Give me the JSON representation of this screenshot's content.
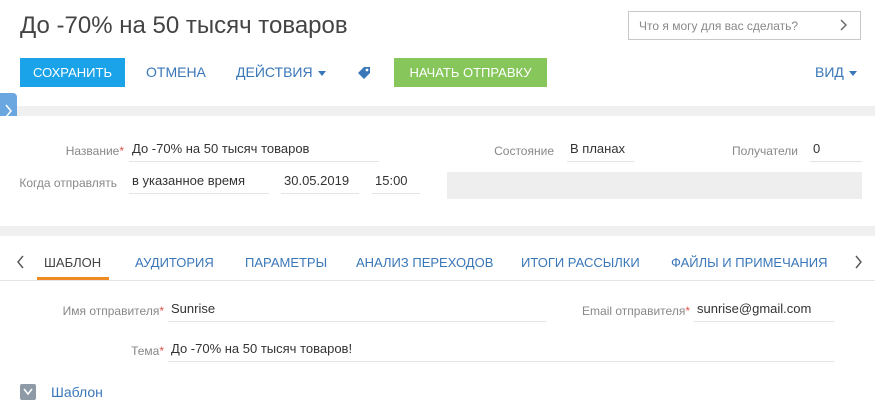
{
  "header": {
    "title": "До -70% на 50 тысяч товаров",
    "assistant_placeholder": "Что я могу для вас сделать?"
  },
  "toolbar": {
    "save_label": "СОХРАНИТЬ",
    "cancel_label": "ОТМЕНА",
    "actions_label": "ДЕЙСТВИЯ",
    "start_send_label": "НАЧАТЬ ОТПРАВКУ",
    "view_label": "ВИД"
  },
  "details": {
    "name_label": "Название",
    "name_value": "До -70% на 50 тысяч товаров",
    "when_label": "Когда отправлять",
    "when_mode": "в указанное время",
    "when_date": "30.05.2019",
    "when_time": "15:00",
    "state_label": "Состояние",
    "state_value": "В планах",
    "recipients_label": "Получатели",
    "recipients_value": "0"
  },
  "tabs": [
    {
      "label": "ШАБЛОН"
    },
    {
      "label": "АУДИТОРИЯ"
    },
    {
      "label": "ПАРАМЕТРЫ"
    },
    {
      "label": "АНАЛИЗ ПЕРЕХОДОВ"
    },
    {
      "label": "ИТОГИ РАССЫЛКИ"
    },
    {
      "label": "ФАЙЛЫ И ПРИМЕЧАНИЯ"
    }
  ],
  "template_tab": {
    "sender_name_label": "Имя отправителя",
    "sender_name_value": "Sunrise",
    "sender_email_label": "Email отправителя",
    "sender_email_value": "sunrise@gmail.com",
    "subject_label": "Тема",
    "subject_value": "До -70% на 50 тысяч товаров!",
    "section_label": "Шаблон"
  },
  "colors": {
    "save_button": "#1aa3e8",
    "start_send_button": "#86c65b",
    "link": "#3a77b8",
    "active_tab_underline": "#f08a24",
    "required_marker": "#e0544c"
  },
  "icons": {
    "tag": "tag-icon",
    "chevron_right": "chevron-right-icon",
    "tabs_prev": "chevron-left-icon",
    "tabs_next": "chevron-right-icon",
    "collapse": "chevron-down-icon"
  }
}
